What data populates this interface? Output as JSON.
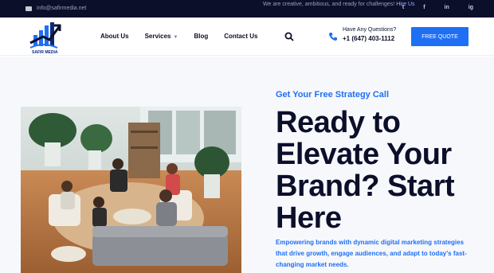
{
  "topbar": {
    "email": "info@safirmedia.net",
    "tagline": "We are creative, ambitious, and ready for challenges!",
    "tagline_link": "Hire Us",
    "socials": [
      "t",
      "f",
      "in",
      "ig"
    ]
  },
  "header": {
    "logo_text": "SAFIR MEDIA",
    "nav": {
      "about": "About Us",
      "services": "Services",
      "blog": "Blog",
      "contact": "Contact Us"
    },
    "contact_question": "Have Any Questions?",
    "phone": "+1 (647) 403-1112",
    "quote_button": "FREE QUOTE"
  },
  "hero": {
    "kicker": "Get Your Free Strategy Call",
    "headline": "Ready to Elevate Your Brand? Start Here",
    "subtext": "Empowering brands with dynamic digital marketing strategies that drive growth, engage audiences, and adapt to today’s fast-changing market needs."
  },
  "colors": {
    "accent": "#1f6ff5",
    "dark": "#0b0f2a",
    "topbar_bg": "#0b0f2a"
  },
  "icons": {
    "mail": "mail-icon",
    "search": "search-icon",
    "phone": "phone-icon"
  }
}
